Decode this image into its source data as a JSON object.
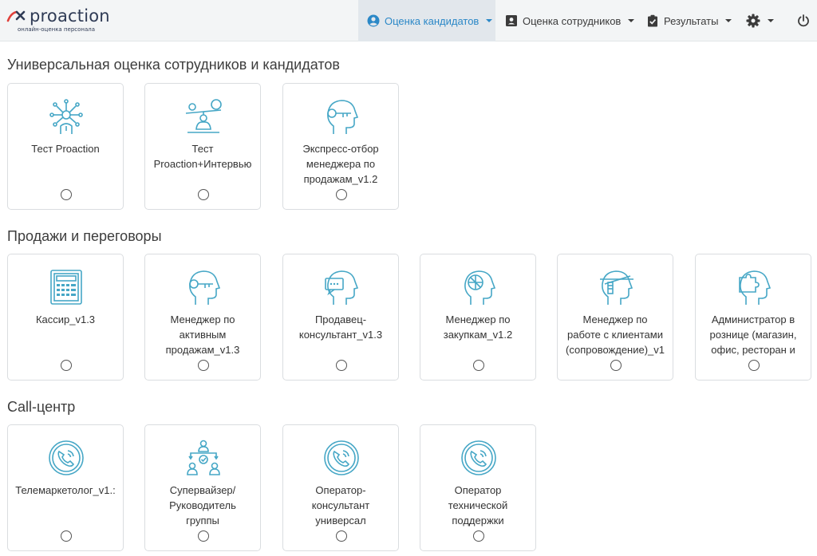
{
  "header": {
    "logo_word": "proaction",
    "logo_tagline": "онлайн-оценка персонала",
    "nav": [
      {
        "label": "Оценка кандидатов",
        "icon": "user-circle-icon",
        "active": true
      },
      {
        "label": "Оценка сотрудников",
        "icon": "id-card-icon",
        "active": false
      },
      {
        "label": "Результаты",
        "icon": "clipboard-check-icon",
        "active": false
      }
    ],
    "settings_icon": "gear-icon",
    "logout_icon": "power-icon"
  },
  "colors": {
    "accent": "#2b88c7",
    "icon_teal": "#46a7c6",
    "topbar_bg": "#f3f5f6",
    "active_nav_bg": "#e2e7ec"
  },
  "sections": [
    {
      "title": "Универсальная оценка сотрудников и кандидатов",
      "cards": [
        {
          "label": "Тест Proaction",
          "icon": "network-head-icon"
        },
        {
          "label": "Тест\nProaction+Интервью",
          "icon": "balance-person-icon"
        },
        {
          "label": "Экспресс-отбор\nменеджера по\nпродажам_v1.2",
          "icon": "head-key-icon"
        }
      ]
    },
    {
      "title": "Продажи и переговоры",
      "cards": [
        {
          "label": "Кассир_v1.3",
          "icon": "cash-register-icon"
        },
        {
          "label": "Менеджер по\nактивным\nпродажам_v1.3",
          "icon": "head-key-icon"
        },
        {
          "label": "Продавец-\nконсультант_v1.3",
          "icon": "head-chat-icon"
        },
        {
          "label": "Менеджер по\nзакупкам_v1.2",
          "icon": "head-target-icon"
        },
        {
          "label": "Менеджер по\nработе с клиентами\n(сопровождение)_v1",
          "icon": "head-scan-icon"
        },
        {
          "label": "Администратор в\nрознице (магазин,\nофис, ресторан и",
          "icon": "head-puzzle-icon"
        }
      ]
    },
    {
      "title": "Call-центр",
      "cards": [
        {
          "label": "Телемаркетолог_v1.:",
          "icon": "phone-circle-icon"
        },
        {
          "label": "Супервайзер/\nРуководитель\nгруппы",
          "icon": "team-hierarchy-icon"
        },
        {
          "label": "Оператор-\nконсультант\nуниверсал",
          "icon": "phone-circle-icon"
        },
        {
          "label": "Оператор\nтехнической\nподдержки",
          "icon": "phone-circle-icon"
        }
      ]
    }
  ]
}
